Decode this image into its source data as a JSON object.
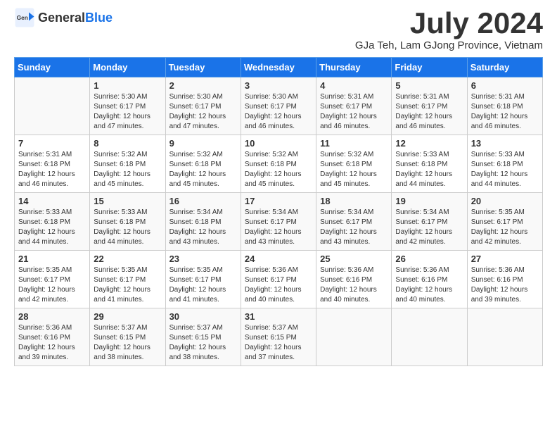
{
  "header": {
    "logo_general": "General",
    "logo_blue": "Blue",
    "month_title": "July 2024",
    "location": "GJa Teh, Lam GJong Province, Vietnam"
  },
  "calendar": {
    "days_of_week": [
      "Sunday",
      "Monday",
      "Tuesday",
      "Wednesday",
      "Thursday",
      "Friday",
      "Saturday"
    ],
    "weeks": [
      [
        {
          "day": "",
          "sunrise": "",
          "sunset": "",
          "daylight": ""
        },
        {
          "day": "1",
          "sunrise": "Sunrise: 5:30 AM",
          "sunset": "Sunset: 6:17 PM",
          "daylight": "Daylight: 12 hours and 47 minutes."
        },
        {
          "day": "2",
          "sunrise": "Sunrise: 5:30 AM",
          "sunset": "Sunset: 6:17 PM",
          "daylight": "Daylight: 12 hours and 47 minutes."
        },
        {
          "day": "3",
          "sunrise": "Sunrise: 5:30 AM",
          "sunset": "Sunset: 6:17 PM",
          "daylight": "Daylight: 12 hours and 46 minutes."
        },
        {
          "day": "4",
          "sunrise": "Sunrise: 5:31 AM",
          "sunset": "Sunset: 6:17 PM",
          "daylight": "Daylight: 12 hours and 46 minutes."
        },
        {
          "day": "5",
          "sunrise": "Sunrise: 5:31 AM",
          "sunset": "Sunset: 6:17 PM",
          "daylight": "Daylight: 12 hours and 46 minutes."
        },
        {
          "day": "6",
          "sunrise": "Sunrise: 5:31 AM",
          "sunset": "Sunset: 6:18 PM",
          "daylight": "Daylight: 12 hours and 46 minutes."
        }
      ],
      [
        {
          "day": "7",
          "sunrise": "Sunrise: 5:31 AM",
          "sunset": "Sunset: 6:18 PM",
          "daylight": "Daylight: 12 hours and 46 minutes."
        },
        {
          "day": "8",
          "sunrise": "Sunrise: 5:32 AM",
          "sunset": "Sunset: 6:18 PM",
          "daylight": "Daylight: 12 hours and 45 minutes."
        },
        {
          "day": "9",
          "sunrise": "Sunrise: 5:32 AM",
          "sunset": "Sunset: 6:18 PM",
          "daylight": "Daylight: 12 hours and 45 minutes."
        },
        {
          "day": "10",
          "sunrise": "Sunrise: 5:32 AM",
          "sunset": "Sunset: 6:18 PM",
          "daylight": "Daylight: 12 hours and 45 minutes."
        },
        {
          "day": "11",
          "sunrise": "Sunrise: 5:32 AM",
          "sunset": "Sunset: 6:18 PM",
          "daylight": "Daylight: 12 hours and 45 minutes."
        },
        {
          "day": "12",
          "sunrise": "Sunrise: 5:33 AM",
          "sunset": "Sunset: 6:18 PM",
          "daylight": "Daylight: 12 hours and 44 minutes."
        },
        {
          "day": "13",
          "sunrise": "Sunrise: 5:33 AM",
          "sunset": "Sunset: 6:18 PM",
          "daylight": "Daylight: 12 hours and 44 minutes."
        }
      ],
      [
        {
          "day": "14",
          "sunrise": "Sunrise: 5:33 AM",
          "sunset": "Sunset: 6:18 PM",
          "daylight": "Daylight: 12 hours and 44 minutes."
        },
        {
          "day": "15",
          "sunrise": "Sunrise: 5:33 AM",
          "sunset": "Sunset: 6:18 PM",
          "daylight": "Daylight: 12 hours and 44 minutes."
        },
        {
          "day": "16",
          "sunrise": "Sunrise: 5:34 AM",
          "sunset": "Sunset: 6:18 PM",
          "daylight": "Daylight: 12 hours and 43 minutes."
        },
        {
          "day": "17",
          "sunrise": "Sunrise: 5:34 AM",
          "sunset": "Sunset: 6:17 PM",
          "daylight": "Daylight: 12 hours and 43 minutes."
        },
        {
          "day": "18",
          "sunrise": "Sunrise: 5:34 AM",
          "sunset": "Sunset: 6:17 PM",
          "daylight": "Daylight: 12 hours and 43 minutes."
        },
        {
          "day": "19",
          "sunrise": "Sunrise: 5:34 AM",
          "sunset": "Sunset: 6:17 PM",
          "daylight": "Daylight: 12 hours and 42 minutes."
        },
        {
          "day": "20",
          "sunrise": "Sunrise: 5:35 AM",
          "sunset": "Sunset: 6:17 PM",
          "daylight": "Daylight: 12 hours and 42 minutes."
        }
      ],
      [
        {
          "day": "21",
          "sunrise": "Sunrise: 5:35 AM",
          "sunset": "Sunset: 6:17 PM",
          "daylight": "Daylight: 12 hours and 42 minutes."
        },
        {
          "day": "22",
          "sunrise": "Sunrise: 5:35 AM",
          "sunset": "Sunset: 6:17 PM",
          "daylight": "Daylight: 12 hours and 41 minutes."
        },
        {
          "day": "23",
          "sunrise": "Sunrise: 5:35 AM",
          "sunset": "Sunset: 6:17 PM",
          "daylight": "Daylight: 12 hours and 41 minutes."
        },
        {
          "day": "24",
          "sunrise": "Sunrise: 5:36 AM",
          "sunset": "Sunset: 6:17 PM",
          "daylight": "Daylight: 12 hours and 40 minutes."
        },
        {
          "day": "25",
          "sunrise": "Sunrise: 5:36 AM",
          "sunset": "Sunset: 6:16 PM",
          "daylight": "Daylight: 12 hours and 40 minutes."
        },
        {
          "day": "26",
          "sunrise": "Sunrise: 5:36 AM",
          "sunset": "Sunset: 6:16 PM",
          "daylight": "Daylight: 12 hours and 40 minutes."
        },
        {
          "day": "27",
          "sunrise": "Sunrise: 5:36 AM",
          "sunset": "Sunset: 6:16 PM",
          "daylight": "Daylight: 12 hours and 39 minutes."
        }
      ],
      [
        {
          "day": "28",
          "sunrise": "Sunrise: 5:36 AM",
          "sunset": "Sunset: 6:16 PM",
          "daylight": "Daylight: 12 hours and 39 minutes."
        },
        {
          "day": "29",
          "sunrise": "Sunrise: 5:37 AM",
          "sunset": "Sunset: 6:15 PM",
          "daylight": "Daylight: 12 hours and 38 minutes."
        },
        {
          "day": "30",
          "sunrise": "Sunrise: 5:37 AM",
          "sunset": "Sunset: 6:15 PM",
          "daylight": "Daylight: 12 hours and 38 minutes."
        },
        {
          "day": "31",
          "sunrise": "Sunrise: 5:37 AM",
          "sunset": "Sunset: 6:15 PM",
          "daylight": "Daylight: 12 hours and 37 minutes."
        },
        {
          "day": "",
          "sunrise": "",
          "sunset": "",
          "daylight": ""
        },
        {
          "day": "",
          "sunrise": "",
          "sunset": "",
          "daylight": ""
        },
        {
          "day": "",
          "sunrise": "",
          "sunset": "",
          "daylight": ""
        }
      ]
    ]
  }
}
